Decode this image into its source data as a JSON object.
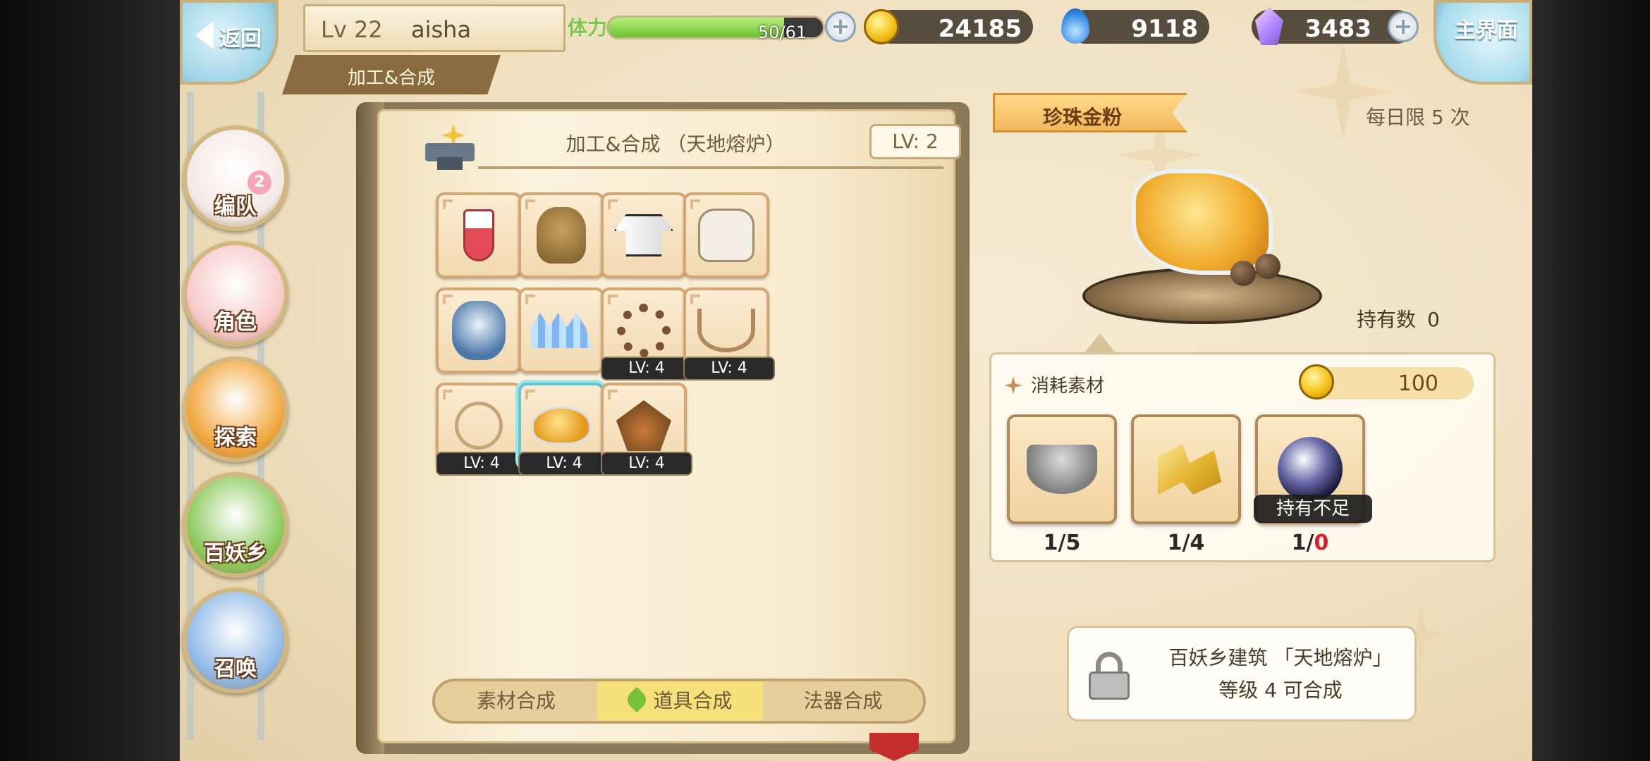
{
  "topbar": {
    "back_label": "返回",
    "level": "Lv 22",
    "player_name": "aisha",
    "section_title": "加工&合成",
    "stamina_label": "体力",
    "stamina_text": "50/61",
    "stamina_fraction": 0.82,
    "gold": "24185",
    "spirit": "9118",
    "gems": "3483",
    "home_label": "主界面"
  },
  "nav": {
    "items": [
      {
        "label": "编队",
        "badge": "2",
        "color": "#f3e9e6"
      },
      {
        "label": "角色",
        "color": "#f7c8c8"
      },
      {
        "label": "探索",
        "color": "#f1a63a"
      },
      {
        "label": "百妖乡",
        "color": "#8ac95a"
      },
      {
        "label": "召唤",
        "color": "#8fb8e6"
      }
    ]
  },
  "book": {
    "title": "加工&合成 （天地熔炉）",
    "level_badge": "LV: 2",
    "items": [
      {
        "name": "red-potion",
        "art": "potion"
      },
      {
        "name": "owl-figure",
        "art": "owl"
      },
      {
        "name": "robe",
        "art": "robe"
      },
      {
        "name": "gloves",
        "art": "gloves"
      },
      {
        "name": "fur-pelt",
        "art": "fur"
      },
      {
        "name": "crystal-shards",
        "art": "crystal"
      },
      {
        "name": "wood-beads",
        "art": "beads",
        "lv": "LV: 4"
      },
      {
        "name": "tooth-necklace",
        "art": "necklace",
        "lv": "LV: 4"
      },
      {
        "name": "rope-charm",
        "art": "rope",
        "lv": "LV: 4"
      },
      {
        "name": "pearl-gold-powder",
        "art": "powder",
        "lv": "LV: 4",
        "selected": true
      },
      {
        "name": "herb-bundle",
        "art": "bundle",
        "lv": "LV: 4"
      }
    ],
    "tabs": [
      "素材合成",
      "道具合成",
      "法器合成"
    ],
    "active_tab": 1
  },
  "detail": {
    "item_name": "珍珠金粉",
    "daily_limit": "每日限 5 次",
    "held_label": "持有数",
    "held_value": "0",
    "materials_title": "消耗素材",
    "gold_cost": "100",
    "materials": [
      {
        "name": "mortar-and-pestle",
        "count": "1/5"
      },
      {
        "name": "gold-cubes",
        "count": "1/4"
      },
      {
        "name": "dark-orb",
        "count_prefix": "1/",
        "count_red": "0",
        "insufficient": "持有不足"
      }
    ],
    "lock_line1": "百妖乡建筑 「天地熔炉」",
    "lock_line2": "等级 4 可合成"
  }
}
